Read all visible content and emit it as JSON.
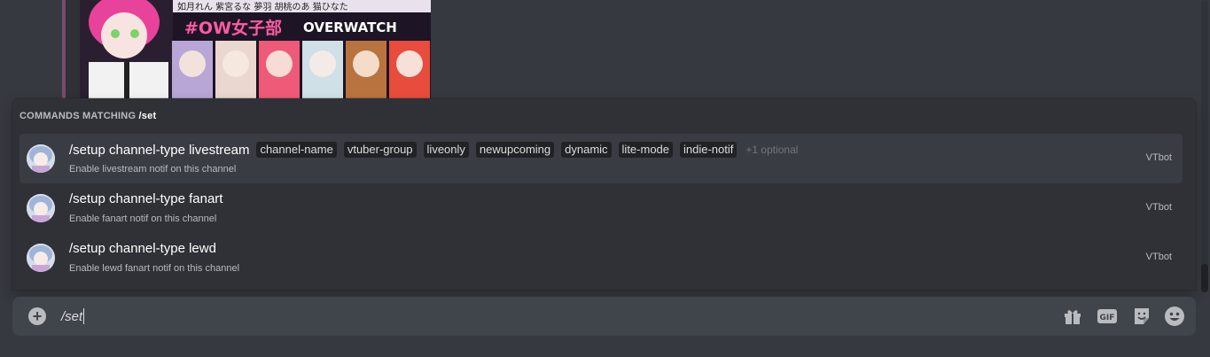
{
  "embed": {
    "image_name": "ow-girls-club-banner"
  },
  "popup": {
    "header_prefix": "COMMANDS MATCHING ",
    "header_query": "/set",
    "commands": [
      {
        "name": "/setup channel-type livestream",
        "options": [
          "channel-name",
          "vtuber-group",
          "liveonly",
          "newupcoming",
          "dynamic",
          "lite-mode",
          "indie-notif"
        ],
        "more": "+1 optional",
        "description": "Enable livestream notif on this channel",
        "bot": "VTbot",
        "selected": true
      },
      {
        "name": "/setup channel-type fanart",
        "options": [],
        "more": "",
        "description": "Enable fanart notif on this channel",
        "bot": "VTbot",
        "selected": false
      },
      {
        "name": "/setup channel-type lewd",
        "options": [],
        "more": "",
        "description": "Enable lewd fanart notif on this channel",
        "bot": "VTbot",
        "selected": false
      }
    ]
  },
  "input": {
    "value": "/set",
    "tools": [
      "gift-icon",
      "gif-icon",
      "sticker-icon",
      "emoji-icon"
    ]
  },
  "colors": {
    "background": "#36393f",
    "popup": "#2f3136",
    "selected_row": "#393c43",
    "input": "#40444b",
    "option_chip": "#202225"
  }
}
